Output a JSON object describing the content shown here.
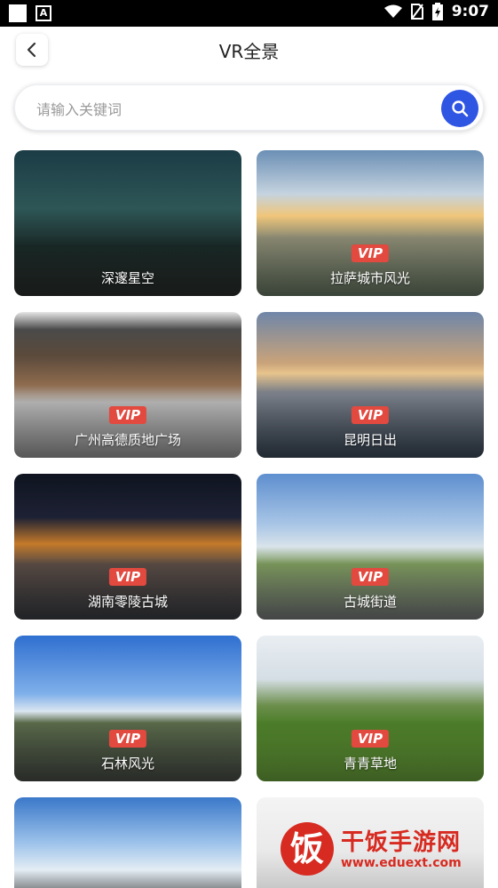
{
  "status_bar": {
    "time": "9:07",
    "icons": [
      "wifi-icon",
      "no-sim-icon",
      "battery-charging-icon"
    ]
  },
  "header": {
    "title": "VR全景",
    "back_icon": "chevron-left-icon"
  },
  "search": {
    "placeholder": "请输入关键词",
    "button_icon": "search-icon",
    "accent": "#2f55e3"
  },
  "cards": [
    {
      "name": "深邃星空",
      "vip": ""
    },
    {
      "name": "拉萨城市风光",
      "vip": "VIP"
    },
    {
      "name": "广州高德质地广场",
      "vip": "VIP"
    },
    {
      "name": "昆明日出",
      "vip": "VIP"
    },
    {
      "name": "湖南零陵古城",
      "vip": "VIP"
    },
    {
      "name": "古城街道",
      "vip": "VIP"
    },
    {
      "name": "石林风光",
      "vip": "VIP"
    },
    {
      "name": "青青草地",
      "vip": "VIP"
    },
    {
      "name": "",
      "vip": ""
    },
    {
      "name": "",
      "vip": ""
    }
  ],
  "watermark": {
    "logo_char": "饭",
    "title": "干饭手游网",
    "url": "www.eduext.com"
  },
  "colors": {
    "vip_badge": "#e2493f",
    "watermark": "#d72a20"
  }
}
